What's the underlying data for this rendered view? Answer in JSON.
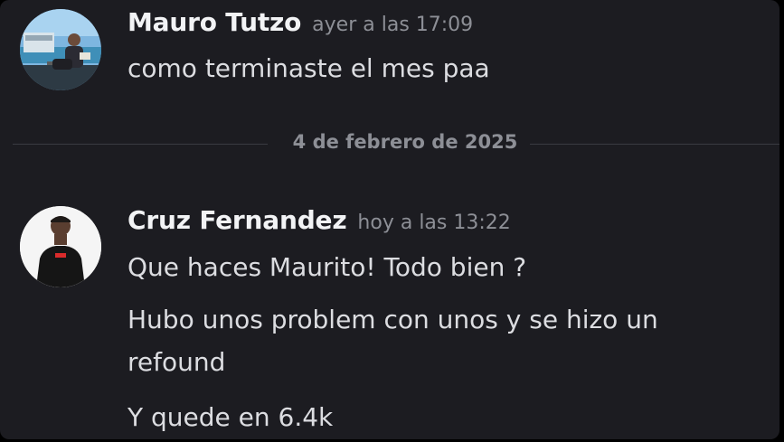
{
  "messages": [
    {
      "author": "Mauro Tutzo",
      "timestamp": "ayer a las 17:09",
      "lines": [
        "como terminaste el mes paa"
      ]
    },
    {
      "author": "Cruz Fernandez",
      "timestamp": "hoy a las 13:22",
      "lines": [
        "Que haces Maurito! Todo bien ?",
        "Hubo unos problem con unos y se hizo un",
        "refound",
        "Y quede en 6.4k"
      ]
    }
  ],
  "date_divider": "4 de febrero de 2025"
}
